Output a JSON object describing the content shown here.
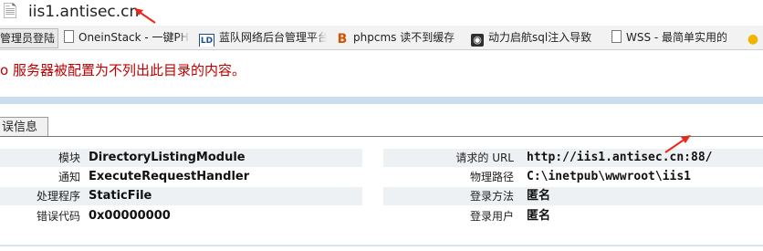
{
  "address_bar": {
    "icon": "page-icon",
    "url": "iis1.antisec.cn",
    "annotation_color": "#e8291c"
  },
  "bookmarks": [
    {
      "label": "管理员登陆",
      "icon": "none"
    },
    {
      "label": "OneinStack - 一键PH",
      "icon": "page-icon"
    },
    {
      "label": "蓝队网络后台管理平台",
      "icon": "ld-logo-icon"
    },
    {
      "label": "phpcms 读不到缓存",
      "icon": "b-logo-icon"
    },
    {
      "label": "动力启航sql注入导致",
      "icon": "camera-icon"
    },
    {
      "label": "WSS - 最简单实用的",
      "icon": "page-icon"
    },
    {
      "label": "",
      "icon": "lightbulb-icon"
    }
  ],
  "page": {
    "headline": "o 服务器被配置为不列出此目录的内容。",
    "headline_color": "#c00000",
    "section_title": "误信息",
    "left_rows": [
      {
        "label": "模块",
        "value": "DirectoryListingModule"
      },
      {
        "label": "通知",
        "value": "ExecuteRequestHandler"
      },
      {
        "label": "处理程序",
        "value": "StaticFile"
      },
      {
        "label": "错误代码",
        "value": "0x00000000"
      }
    ],
    "right_rows": [
      {
        "label": "请求的 URL",
        "value": "http://iis1.antisec.cn:88/"
      },
      {
        "label": "物理路径",
        "value": "C:\\inetpub\\wwwroot\\iis1"
      },
      {
        "label": "登录方法",
        "value": "匿名"
      },
      {
        "label": "登录用户",
        "value": "匿名"
      }
    ]
  }
}
